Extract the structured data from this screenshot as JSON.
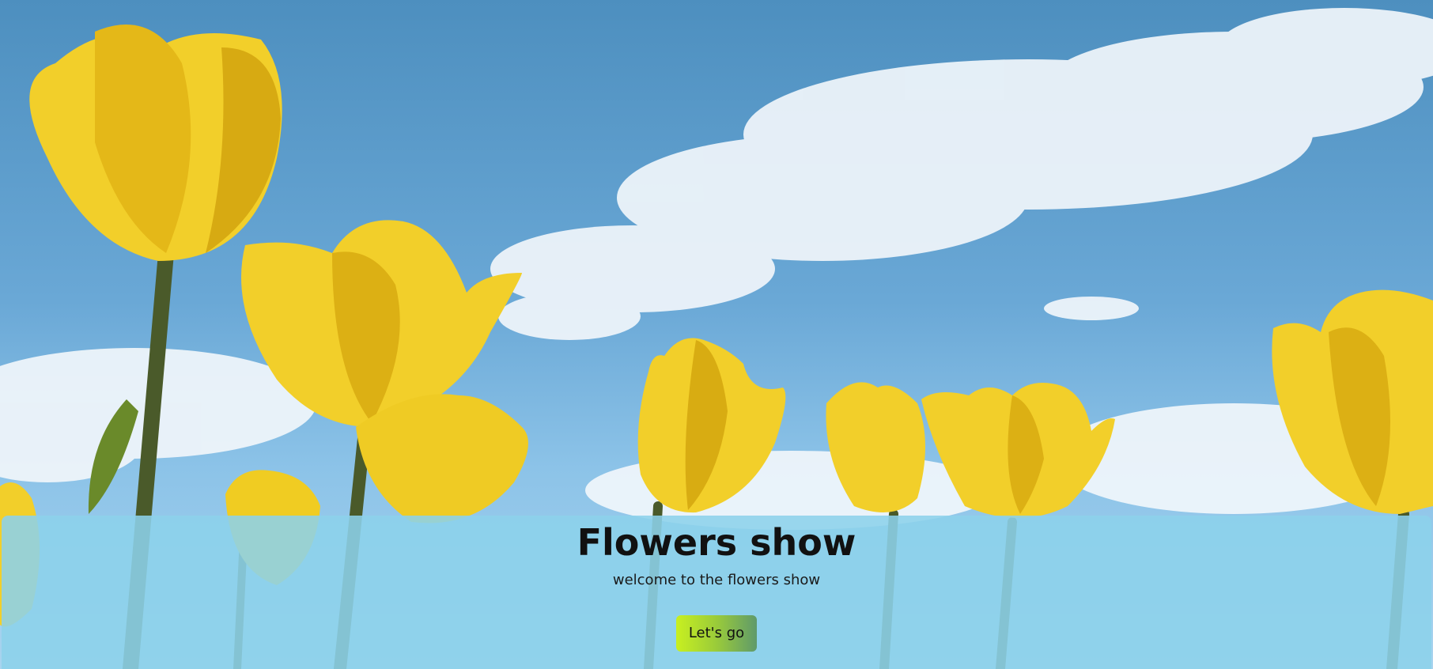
{
  "hero": {
    "title": "Flowers show",
    "subtitle": "welcome to the flowers show",
    "cta_label": "Let's go",
    "background_image": "yellow-tulips-under-blue-sky"
  },
  "colors": {
    "sky": "#5a9ccc",
    "cloud": "#eef5fb",
    "tulip": "#f2cf2a",
    "tulip_shade": "#d4a80f",
    "stem": "#4a5a2a",
    "panel": "#8cd2eb",
    "button_start": "#c8f020",
    "button_end": "#5f9a6a"
  }
}
